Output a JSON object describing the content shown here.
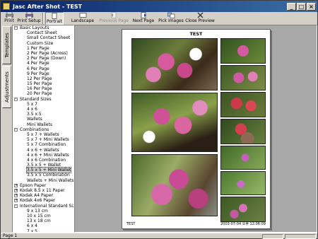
{
  "window": {
    "title": "Jasc After Shot - TEST",
    "controls": [
      "_",
      "□",
      "×"
    ]
  },
  "toolbar": {
    "buttons": [
      {
        "label": "Print",
        "icon": "printer-icon",
        "enabled": true
      },
      {
        "label": "Print Setup",
        "icon": "print-setup-icon",
        "enabled": true
      },
      {
        "label": "Portrait",
        "icon": "portrait-icon",
        "enabled": true
      },
      {
        "label": "Landscape",
        "icon": "landscape-icon",
        "enabled": true
      },
      {
        "label": "Previous Page",
        "icon": "previous-page-icon",
        "enabled": false
      },
      {
        "label": "Next Page",
        "icon": "next-page-icon",
        "enabled": true
      },
      {
        "label": "Pick Images",
        "icon": "pick-images-icon",
        "enabled": true
      },
      {
        "label": "Close Preview",
        "icon": "close-preview-icon",
        "enabled": true
      }
    ]
  },
  "side_tabs": {
    "templates": "Templates",
    "adjustments": "Adjustments"
  },
  "tree": [
    {
      "label": "Basic Layouts",
      "level": 0,
      "expander": "-"
    },
    {
      "label": "Contact Sheet",
      "level": 1
    },
    {
      "label": "Small Contact Sheet",
      "level": 1
    },
    {
      "label": "Custom Size",
      "level": 1
    },
    {
      "label": "1 Per Page",
      "level": 1
    },
    {
      "label": "2 Per Page (Across)",
      "level": 1
    },
    {
      "label": "2 Per Page (Down)",
      "level": 1
    },
    {
      "label": "4 Per Page",
      "level": 1
    },
    {
      "label": "6 Per Page",
      "level": 1
    },
    {
      "label": "9 Per Page",
      "level": 1
    },
    {
      "label": "12 Per Page",
      "level": 1
    },
    {
      "label": "15 Per Page",
      "level": 1
    },
    {
      "label": "16 Per Page",
      "level": 1
    },
    {
      "label": "20 Per Page",
      "level": 1
    },
    {
      "label": "Standard Sizes",
      "level": 0,
      "expander": "-"
    },
    {
      "label": "5 x 7",
      "level": 1
    },
    {
      "label": "4 x 6",
      "level": 1
    },
    {
      "label": "3.5 x 5",
      "level": 1
    },
    {
      "label": "Wallets",
      "level": 1
    },
    {
      "label": "Mini Wallets",
      "level": 1
    },
    {
      "label": "Combinations",
      "level": 0,
      "expander": "-"
    },
    {
      "label": "5 x 7 + Wallets",
      "level": 1
    },
    {
      "label": "5 x 7 + Mini Wallets",
      "level": 1
    },
    {
      "label": "5 x 7 Combination",
      "level": 1
    },
    {
      "label": "4 x 6 + Wallets",
      "level": 1
    },
    {
      "label": "4 x 6 + Mini Wallets",
      "level": 1
    },
    {
      "label": "4 x 6 Combination",
      "level": 1
    },
    {
      "label": "3.5 x 5 + Wallet",
      "level": 1
    },
    {
      "label": "3.5 x 5 + Mini Wallet",
      "level": 1,
      "selected": true
    },
    {
      "label": "3.5 x 5 Combination",
      "level": 1
    },
    {
      "label": "Wallets + Mini Wallets",
      "level": 1
    },
    {
      "label": "Epson Paper",
      "level": 0,
      "expander": "+"
    },
    {
      "label": "Kodak 8.5 x 11 Paper",
      "level": 0,
      "expander": "+"
    },
    {
      "label": "Kodak A4 Paper",
      "level": 0,
      "expander": "+"
    },
    {
      "label": "Kodak 4x6 Paper",
      "level": 0,
      "expander": "+"
    },
    {
      "label": "International Standard Sizes",
      "level": 0,
      "expander": "-"
    },
    {
      "label": "9 x 13 cm",
      "level": 1
    },
    {
      "label": "10 x 15 cm",
      "level": 1
    },
    {
      "label": "13 x 18 cm",
      "level": 1
    },
    {
      "label": "6 x 4",
      "level": 1
    },
    {
      "label": "7 x 5",
      "level": 1
    },
    {
      "label": "8 x 6",
      "level": 1
    }
  ],
  "preview": {
    "page_title": "TEST",
    "footer_left": "TEST",
    "footer_right": "2003-07-04 오후 12:06:09"
  },
  "status": {
    "text": "Page 1"
  },
  "colors": {
    "title_start": "#0a246a",
    "title_end": "#3a6ea5",
    "workspace": "#a8a8a8",
    "selection": "#d0d0d0"
  }
}
